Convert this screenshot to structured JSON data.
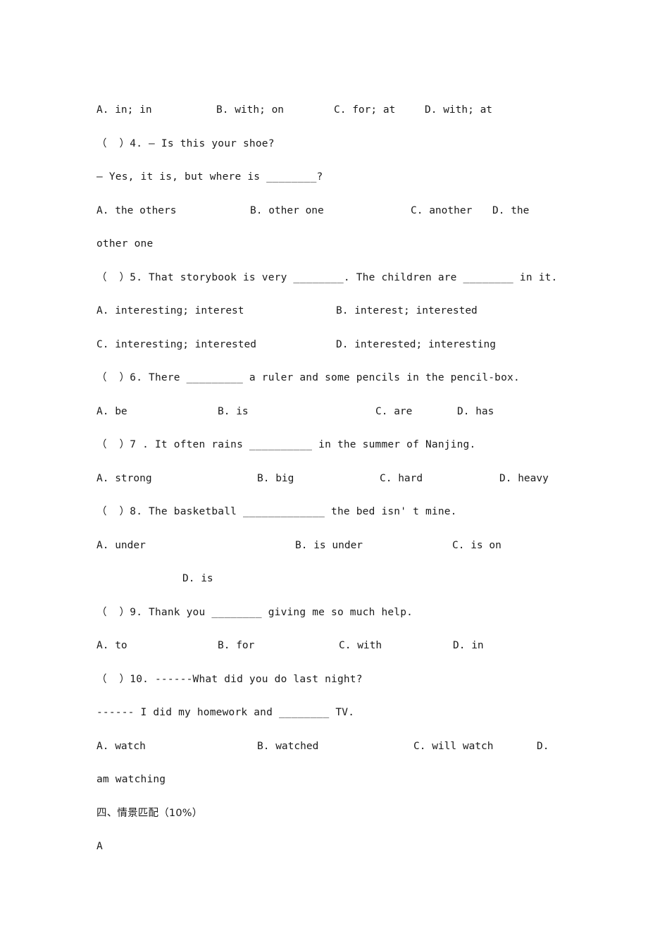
{
  "document": {
    "type": "english-exam-worksheet",
    "background_color": "#ffffff",
    "text_color": "#1a1a1a"
  },
  "lines": {
    "q3_options": {
      "a": "A. in; in",
      "b": "B. with; on",
      "c": "C. for; at",
      "d": "D. with; at"
    },
    "q4_stem": "（  ）4. — Is this your shoe?",
    "q4_reply": "— Yes, it is, but where is ________?",
    "q4_options": {
      "a": "A. the others",
      "b": "B. other one",
      "c": "C. another",
      "d": "D. the",
      "d_wrap": "other one"
    },
    "q5_stem": "（  ）5. That storybook is very ________. The children are ________ in it.",
    "q5_options": {
      "a": "A. interesting; interest",
      "b": "B. interest; interested",
      "c": "C. interesting; interested",
      "d": "D. interested; interesting"
    },
    "q6_stem": "（  ）6. There _________ a ruler and some pencils in the pencil-box.",
    "q6_options": {
      "a": "A. be",
      "b": "B. is",
      "c": "C. are",
      "d": "D. has"
    },
    "q7_stem": "（  ）7 . It often rains __________ in the summer of Nanjing.",
    "q7_options": {
      "a": "A. strong",
      "b": "B. big",
      "c": "C. hard",
      "d": "D. heavy"
    },
    "q8_stem": "（  ）8. The basketball _____________ the bed isn' t mine.",
    "q8_options": {
      "a": "A. under",
      "b": "B. is under",
      "c": "C. is on",
      "d": "D. is"
    },
    "q9_stem": "（  ）9. Thank you ________ giving me so much help.",
    "q9_options": {
      "a": "A. to",
      "b": "B. for",
      "c": "C. with",
      "d": "D. in"
    },
    "q10_stem": "（  ）10. ------What did you do last night?",
    "q10_reply": "------ I did my homework and ________ TV.",
    "q10_options": {
      "a": "A. watch",
      "b": "B. watched",
      "c": "C. will watch",
      "d": "D.",
      "d_wrap": "am watching"
    },
    "section_four_heading": "四、情景匹配（10%）",
    "section_four_label": "A"
  }
}
